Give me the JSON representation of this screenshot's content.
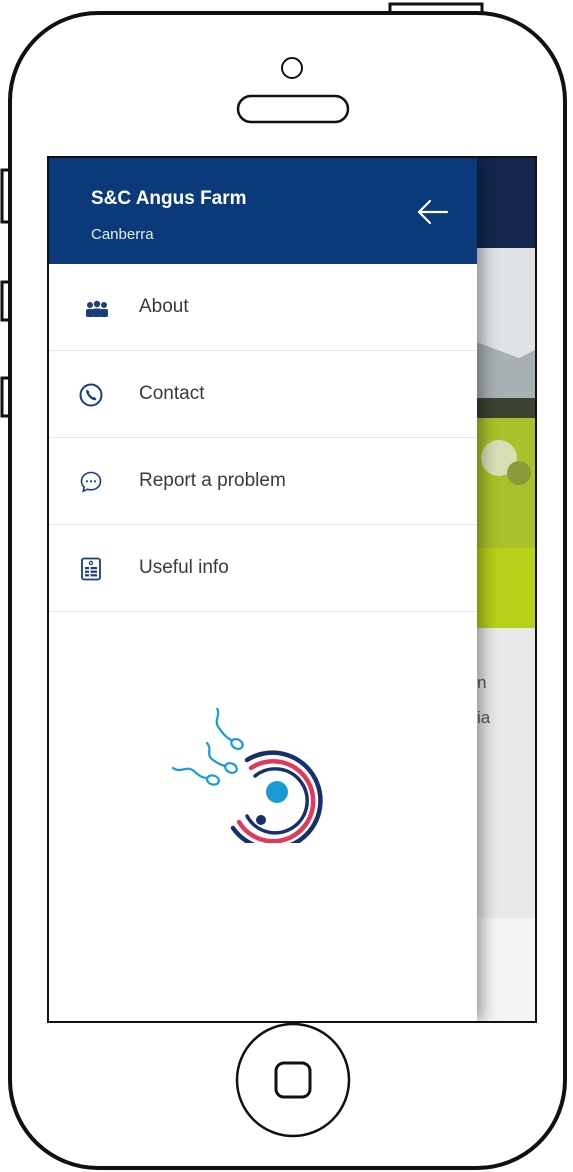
{
  "drawer": {
    "farm_name": "S&C Angus Farm",
    "location": "Canberra",
    "back_icon": "arrow-left-icon",
    "items": [
      {
        "label": "About",
        "icon": "people-icon"
      },
      {
        "label": "Contact",
        "icon": "phone-icon"
      },
      {
        "label": "Report a problem",
        "icon": "chat-bubble-icon"
      },
      {
        "label": "Useful info",
        "icon": "document-icon"
      }
    ]
  },
  "background_app": {
    "partial_text_1": "n",
    "partial_text_2": "ia"
  },
  "colors": {
    "drawer_header": "#0b3a7a",
    "icon_blue": "#1a3f7a",
    "logo_red": "#e0395b",
    "logo_navy": "#17306b",
    "logo_cyan": "#1c9ad6"
  }
}
